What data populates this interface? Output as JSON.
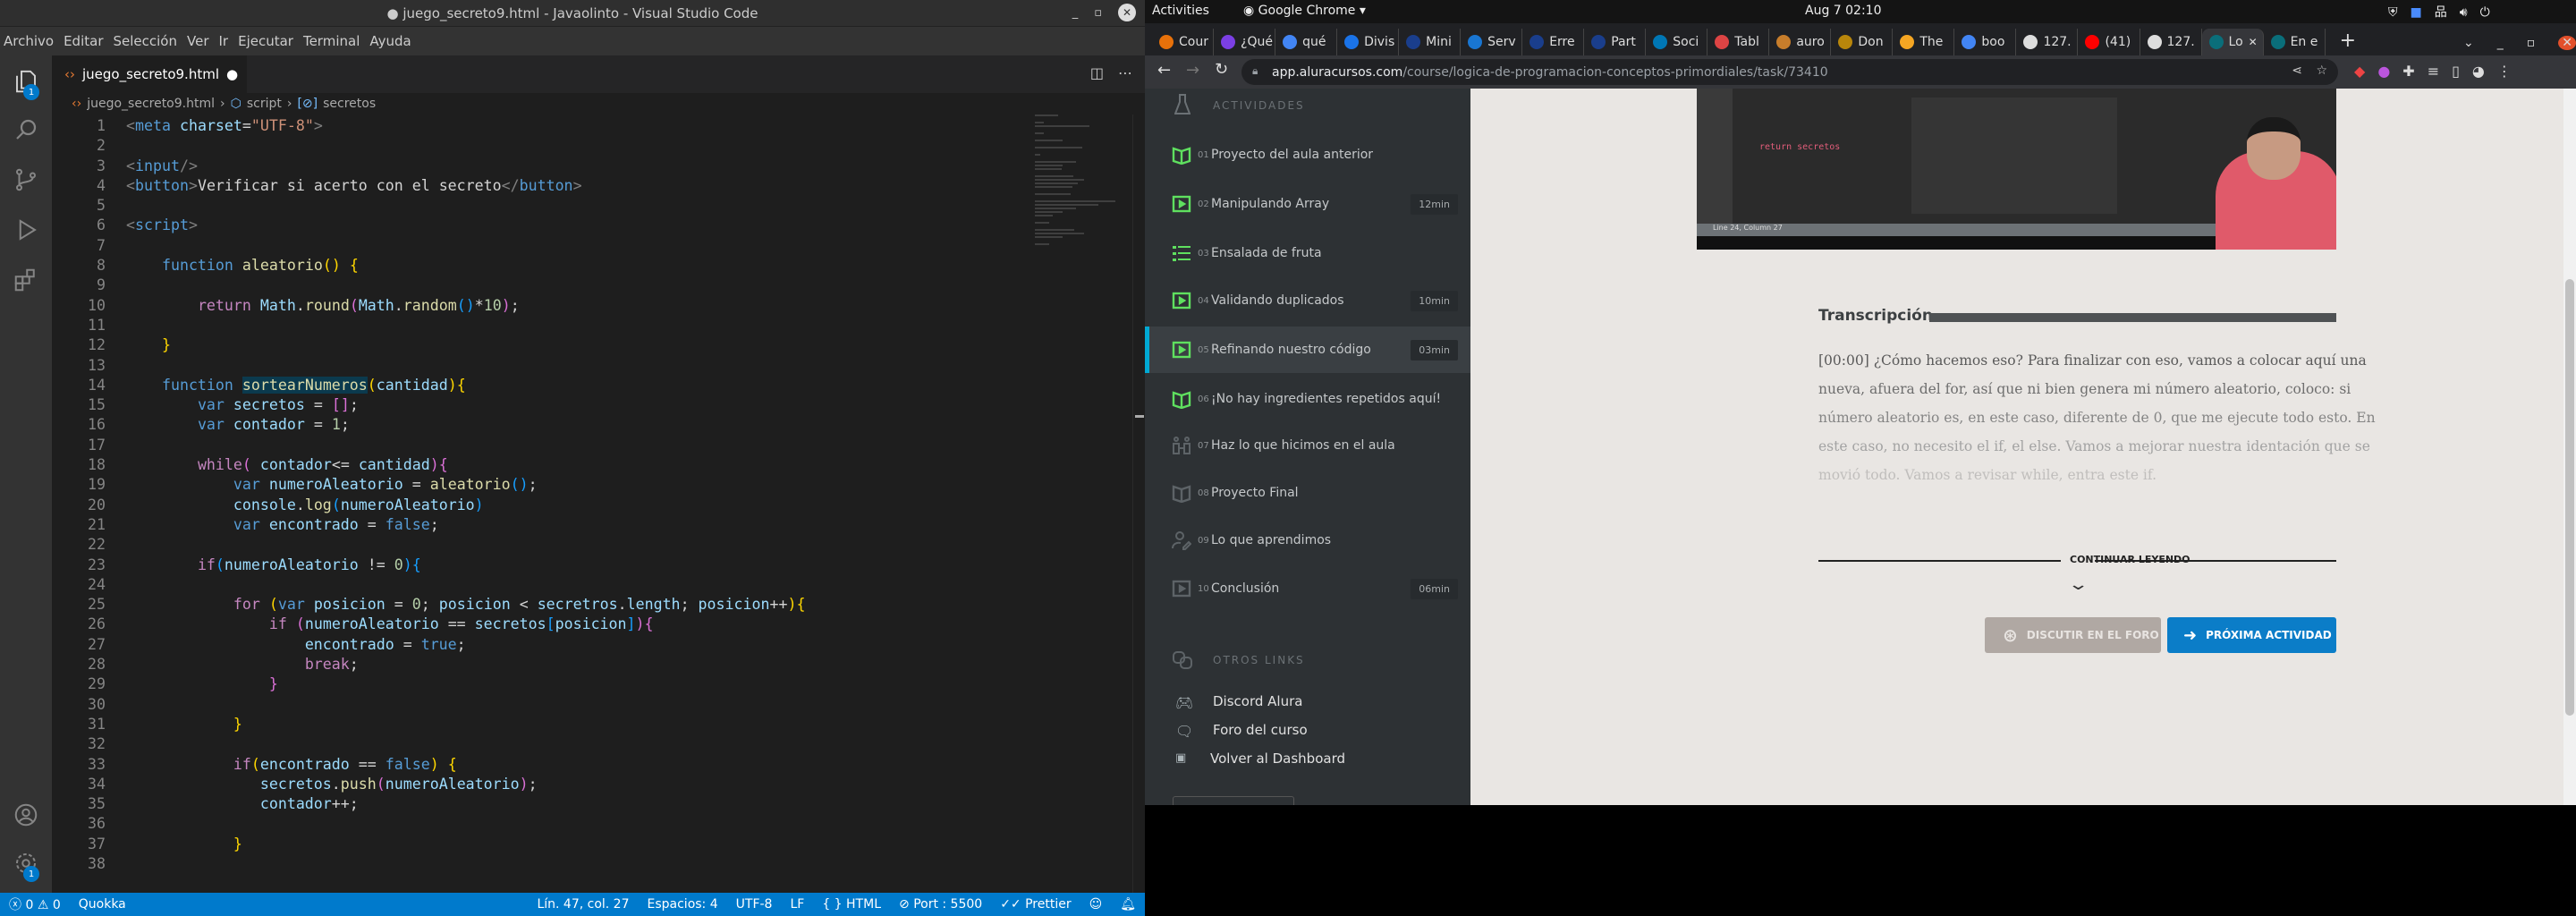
{
  "vscode": {
    "window_title": "● juego_secreto9.html - Javaolinto - Visual Studio Code",
    "menu": [
      "Archivo",
      "Editar",
      "Selección",
      "Ver",
      "Ir",
      "Ejecutar",
      "Terminal",
      "Ayuda"
    ],
    "explorer_badge": "1",
    "accounts_badge": "1",
    "tab": {
      "label": "juego_secreto9.html",
      "modified": "●"
    },
    "breadcrumb": [
      "juego_secreto9.html",
      "script",
      "secretos"
    ],
    "code_lines": [
      [
        [
          "tg",
          "<"
        ],
        [
          "tgn",
          "meta"
        ],
        [
          "tx",
          " "
        ],
        [
          "at",
          "charset"
        ],
        [
          "tx",
          "="
        ],
        [
          "st",
          "\"UTF-8\""
        ],
        [
          "tg",
          ">"
        ]
      ],
      [],
      [
        [
          "tg",
          "<"
        ],
        [
          "tgn",
          "input"
        ],
        [
          "tg",
          "/>"
        ]
      ],
      [
        [
          "tg",
          "<"
        ],
        [
          "tgn",
          "button"
        ],
        [
          "tg",
          ">"
        ],
        [
          "tx",
          "Verificar si acerto con el secreto"
        ],
        [
          "tg",
          "</"
        ],
        [
          "tgn",
          "button"
        ],
        [
          "tg",
          ">"
        ]
      ],
      [],
      [
        [
          "tg",
          "<"
        ],
        [
          "tgn",
          "script"
        ],
        [
          "tg",
          ">"
        ]
      ],
      [],
      [
        [
          "tx",
          "    "
        ],
        [
          "kw",
          "function"
        ],
        [
          "tx",
          " "
        ],
        [
          "fn",
          "aleatorio"
        ],
        [
          "b1",
          "()"
        ],
        [
          "tx",
          " "
        ],
        [
          "b1",
          "{"
        ]
      ],
      [],
      [
        [
          "tx",
          "        "
        ],
        [
          "ctl",
          "return"
        ],
        [
          "tx",
          " "
        ],
        [
          "vr",
          "Math"
        ],
        [
          "tx",
          "."
        ],
        [
          "fn",
          "round"
        ],
        [
          "b2",
          "("
        ],
        [
          "vr",
          "Math"
        ],
        [
          "tx",
          "."
        ],
        [
          "fn",
          "random"
        ],
        [
          "b3",
          "()"
        ],
        [
          "tx",
          "*"
        ],
        [
          "nm",
          "10"
        ],
        [
          "b2",
          ")"
        ],
        [
          "tx",
          ";"
        ]
      ],
      [],
      [
        [
          "tx",
          "    "
        ],
        [
          "b1",
          "}"
        ]
      ],
      [],
      [
        [
          "tx",
          "    "
        ],
        [
          "kw",
          "function"
        ],
        [
          "tx",
          " "
        ],
        [
          "hl",
          "sortearNumeros"
        ],
        [
          "b1",
          "("
        ],
        [
          "vr",
          "cantidad"
        ],
        [
          "b1",
          ")"
        ],
        [
          "b1",
          "{"
        ]
      ],
      [
        [
          "tx",
          "        "
        ],
        [
          "kw",
          "var"
        ],
        [
          "tx",
          " "
        ],
        [
          "vr",
          "secretos"
        ],
        [
          "tx",
          " = "
        ],
        [
          "b2",
          "[]"
        ],
        [
          "tx",
          ";"
        ]
      ],
      [
        [
          "tx",
          "        "
        ],
        [
          "kw",
          "var"
        ],
        [
          "tx",
          " "
        ],
        [
          "vr",
          "contador"
        ],
        [
          "tx",
          " = "
        ],
        [
          "nm",
          "1"
        ],
        [
          "tx",
          ";"
        ]
      ],
      [],
      [
        [
          "tx",
          "        "
        ],
        [
          "ctl",
          "while"
        ],
        [
          "b2",
          "("
        ],
        [
          "tx",
          " "
        ],
        [
          "vr",
          "contador"
        ],
        [
          "tx",
          "<= "
        ],
        [
          "vr",
          "cantidad"
        ],
        [
          "b2",
          ")"
        ],
        [
          "b2",
          "{"
        ]
      ],
      [
        [
          "tx",
          "            "
        ],
        [
          "kw",
          "var"
        ],
        [
          "tx",
          " "
        ],
        [
          "vr",
          "numeroAleatorio"
        ],
        [
          "tx",
          " = "
        ],
        [
          "fn",
          "aleatorio"
        ],
        [
          "b3",
          "()"
        ],
        [
          "tx",
          ";"
        ]
      ],
      [
        [
          "tx",
          "            "
        ],
        [
          "vr",
          "console"
        ],
        [
          "tx",
          "."
        ],
        [
          "fn",
          "log"
        ],
        [
          "b3",
          "("
        ],
        [
          "vr",
          "numeroAleatorio"
        ],
        [
          "b3",
          ")"
        ]
      ],
      [
        [
          "tx",
          "            "
        ],
        [
          "kw",
          "var"
        ],
        [
          "tx",
          " "
        ],
        [
          "vr",
          "encontrado"
        ],
        [
          "tx",
          " = "
        ],
        [
          "kw",
          "false"
        ],
        [
          "tx",
          ";"
        ]
      ],
      [],
      [
        [
          "tx",
          "        "
        ],
        [
          "ctl",
          "if"
        ],
        [
          "b3",
          "("
        ],
        [
          "vr",
          "numeroAleatorio"
        ],
        [
          "tx",
          " != "
        ],
        [
          "nm",
          "0"
        ],
        [
          "b3",
          ")"
        ],
        [
          "b3",
          "{"
        ]
      ],
      [],
      [
        [
          "tx",
          "            "
        ],
        [
          "ctl",
          "for"
        ],
        [
          "tx",
          " "
        ],
        [
          "b1",
          "("
        ],
        [
          "kw",
          "var"
        ],
        [
          "tx",
          " "
        ],
        [
          "vr",
          "posicion"
        ],
        [
          "tx",
          " = "
        ],
        [
          "nm",
          "0"
        ],
        [
          "tx",
          "; "
        ],
        [
          "vr",
          "posicion"
        ],
        [
          "tx",
          " < "
        ],
        [
          "vr",
          "secretros"
        ],
        [
          "tx",
          "."
        ],
        [
          "vr",
          "length"
        ],
        [
          "tx",
          "; "
        ],
        [
          "vr",
          "posicion"
        ],
        [
          "tx",
          "++"
        ],
        [
          "b1",
          ")"
        ],
        [
          "b1",
          "{"
        ]
      ],
      [
        [
          "tx",
          "                "
        ],
        [
          "ctl",
          "if"
        ],
        [
          "tx",
          " "
        ],
        [
          "b2",
          "("
        ],
        [
          "vr",
          "numeroAleatorio"
        ],
        [
          "tx",
          " == "
        ],
        [
          "vr",
          "secretos"
        ],
        [
          "b3",
          "["
        ],
        [
          "vr",
          "posicion"
        ],
        [
          "b3",
          "]"
        ],
        [
          "b2",
          ")"
        ],
        [
          "b2",
          "{"
        ]
      ],
      [
        [
          "tx",
          "                    "
        ],
        [
          "vr",
          "encontrado"
        ],
        [
          "tx",
          " = "
        ],
        [
          "kw",
          "true"
        ],
        [
          "tx",
          ";"
        ]
      ],
      [
        [
          "tx",
          "                    "
        ],
        [
          "ctl",
          "break"
        ],
        [
          "tx",
          ";"
        ]
      ],
      [
        [
          "tx",
          "                "
        ],
        [
          "b2",
          "}"
        ]
      ],
      [],
      [
        [
          "tx",
          "            "
        ],
        [
          "b1",
          "}"
        ]
      ],
      [],
      [
        [
          "tx",
          "            "
        ],
        [
          "ctl",
          "if"
        ],
        [
          "b1",
          "("
        ],
        [
          "vr",
          "encontrado"
        ],
        [
          "tx",
          " == "
        ],
        [
          "kw",
          "false"
        ],
        [
          "b1",
          ")"
        ],
        [
          "tx",
          " "
        ],
        [
          "b1",
          "{"
        ]
      ],
      [
        [
          "tx",
          "               "
        ],
        [
          "vr",
          "secretos"
        ],
        [
          "tx",
          "."
        ],
        [
          "fn",
          "push"
        ],
        [
          "b2",
          "("
        ],
        [
          "vr",
          "numeroAleatorio"
        ],
        [
          "b2",
          ")"
        ],
        [
          "tx",
          ";"
        ]
      ],
      [
        [
          "tx",
          "               "
        ],
        [
          "vr",
          "contador"
        ],
        [
          "tx",
          "++;"
        ]
      ],
      [],
      [
        [
          "tx",
          "            "
        ],
        [
          "b1",
          "}"
        ]
      ],
      []
    ],
    "status": {
      "errors": "0",
      "warnings": "0",
      "quokka": "Quokka",
      "position": "Lín. 47, col. 27",
      "spaces": "Espacios: 4",
      "encoding": "UTF-8",
      "eol": "LF",
      "language": "HTML",
      "port": "Port : 5500",
      "prettier": "Prettier"
    }
  },
  "topbar": {
    "activities": "Activities",
    "app": "Google Chrome ▾",
    "clock": "Aug 7  02:10"
  },
  "chrome": {
    "tabs": [
      {
        "label": "Cour",
        "color": "#e8710a"
      },
      {
        "label": "¿Qué",
        "color": "#7b3fe4"
      },
      {
        "label": "qué",
        "color": "#4285f4"
      },
      {
        "label": "Divis",
        "color": "#1a73e8"
      },
      {
        "label": "Mini",
        "color": "#1a3e8c"
      },
      {
        "label": "Serv",
        "color": "#1976d2"
      },
      {
        "label": "Erre",
        "color": "#1a3e8c"
      },
      {
        "label": "Part",
        "color": "#1a3e8c"
      },
      {
        "label": "Soci",
        "color": "#0077b5"
      },
      {
        "label": "Tabl",
        "color": "#d44"
      },
      {
        "label": "auro",
        "color": "#c77d2b"
      },
      {
        "label": "Don",
        "color": "#b8860b"
      },
      {
        "label": "The",
        "color": "#f5a623"
      },
      {
        "label": "boo",
        "color": "#4285f4"
      },
      {
        "label": "127.",
        "color": "#ddd"
      },
      {
        "label": "(41)",
        "color": "#ff0000"
      },
      {
        "label": "127.",
        "color": "#ddd"
      },
      {
        "label": "Lo",
        "color": "#0a6e7a",
        "active": true
      },
      {
        "label": "En e",
        "color": "#0a6e7a"
      }
    ],
    "new_tab": "+",
    "url_host": "app.aluracursos.com",
    "url_path": "/course/logica-de-programacion-conceptos-primordiales/task/73410"
  },
  "sidebar": {
    "section_title": "ACTIVIDADES",
    "items": [
      {
        "num": "01",
        "label": "Proyecto del aula anterior",
        "icon": "book",
        "done": true
      },
      {
        "num": "02",
        "label": "Manipulando Array",
        "icon": "video",
        "done": true,
        "duration": "12min"
      },
      {
        "num": "03",
        "label": "Ensalada de fruta",
        "icon": "list",
        "done": true
      },
      {
        "num": "04",
        "label": "Validando duplicados",
        "icon": "video",
        "done": true,
        "duration": "10min"
      },
      {
        "num": "05",
        "label": "Refinando nuestro código",
        "icon": "video",
        "done": true,
        "duration": "03min",
        "active": true
      },
      {
        "num": "06",
        "label": "¡No hay ingredientes repetidos aquí!",
        "icon": "book",
        "done": true
      },
      {
        "num": "07",
        "label": "Haz lo que hicimos en el aula",
        "icon": "people",
        "done": false
      },
      {
        "num": "08",
        "label": "Proyecto Final",
        "icon": "book",
        "done": false
      },
      {
        "num": "09",
        "label": "Lo que aprendimos",
        "icon": "user-edit",
        "done": false
      },
      {
        "num": "10",
        "label": "Conclusión",
        "icon": "video",
        "done": false,
        "duration": "06min"
      }
    ],
    "other_title": "OTROS LINKS",
    "links": [
      "Discord Alura",
      "Foro del curso",
      "Volver al Dashboard"
    ]
  },
  "main": {
    "video_status": "Line 24, Column 27",
    "transcript_title": "Transcripción",
    "transcript_lines": [
      "[00:00] ¿Cómo hacemos eso? Para finalizar con eso, vamos a colocar aquí una",
      "nueva, afuera del for, así que ni bien genera mi número aleatorio, coloco: si",
      "número aleatorio es, en este caso, diferente de 0, que me ejecute todo esto. En",
      "este caso, no necesito el if, el else. Vamos a mejorar nuestra identación que se",
      "movió todo. Vamos a revisar while, entra este if."
    ],
    "continue_label": "CONTINUAR LEYENDO",
    "forum_button": "DISCUTIR EN EL FORO",
    "next_button": "PRÓXIMA ACTIVIDAD",
    "colors": {
      "primary": "#0b7dc8",
      "forum": "#b0a8a3",
      "done_icon": "#5fe05f",
      "active_bar": "#00a9d4"
    }
  }
}
